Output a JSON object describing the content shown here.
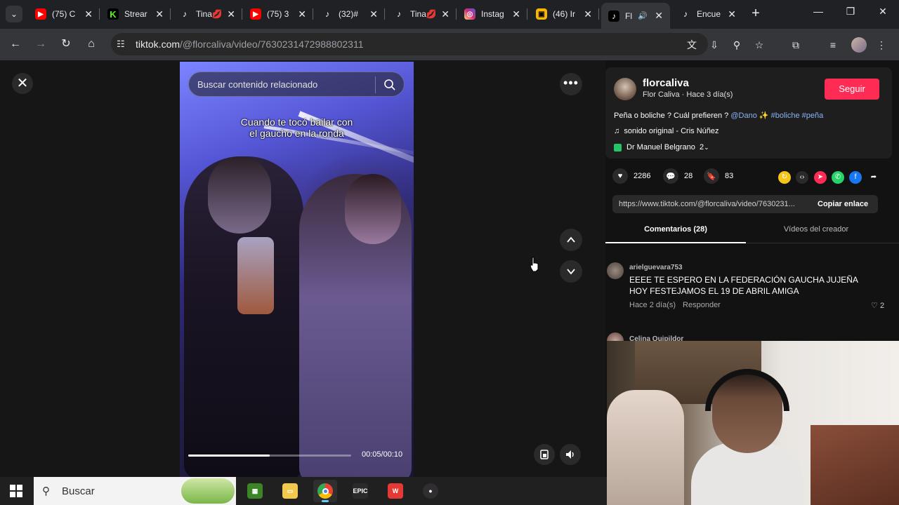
{
  "browser": {
    "tabs": [
      {
        "title": "(75) C",
        "icon": "youtube-icon",
        "color": "#ff0000"
      },
      {
        "title": "Strear",
        "icon": "kick-icon",
        "color": "#53fc18"
      },
      {
        "title": "Tina💋",
        "icon": "tiktok-icon",
        "color": "#ffffff"
      },
      {
        "title": "(75) 3",
        "icon": "youtube-icon",
        "color": "#ff0000"
      },
      {
        "title": "(32)#",
        "icon": "tiktok-icon",
        "color": "#ffffff"
      },
      {
        "title": "Tina💋",
        "icon": "tiktok-icon",
        "color": "#ffffff"
      },
      {
        "title": "Instag",
        "icon": "instagram-icon",
        "color": "#e1306c"
      },
      {
        "title": "(46) Ir",
        "icon": "gallery-icon",
        "color": "#f7b500"
      },
      {
        "title": "Fl",
        "icon": "tiktok-icon",
        "color": "#ffffff",
        "active": true
      },
      {
        "title": "Encue",
        "icon": "tiktok-icon",
        "color": "#ffffff"
      }
    ],
    "url_host": "tiktok.com",
    "url_path": "/@florcaliva/video/7630231472988802311"
  },
  "player": {
    "search_placeholder": "Buscar contenido relacionado",
    "caption_line1": "Cuando te tocó bailar con",
    "caption_line2": "el gaucho en la ronda",
    "time": "00:05/00:10",
    "progress": 0.5
  },
  "post": {
    "username": "florcaliva",
    "subline": "Flor Caliva · Hace 3 día(s)",
    "follow_label": "Seguir",
    "desc_text": "Peña o boliche ? Cuál prefieren ? ",
    "desc_mention": "@Dano",
    "desc_sparkle": " ✨",
    "desc_tags": "#boliche #peña",
    "sound": "sonido original - Cris Núñez",
    "place": "Dr Manuel Belgrano",
    "place_count": "2",
    "likes": "2286",
    "comments": "28",
    "saves": "83",
    "link_url": "https://www.tiktok.com/@florcaliva/video/7630231...",
    "copy_label": "Copiar enlace",
    "tab_comments": "Comentarios (28)",
    "tab_videos": "Vídeos del creador"
  },
  "comments": [
    {
      "user": "arielguevara753",
      "text": "EEEE TE ESPERO EN LA FEDERACIÓN GAUCHA JUJEÑA HOY FESTEJAMOS EL 19 DE ABRIL AMIGA",
      "age": "Hace 2 día(s)",
      "reply": "Responder",
      "likes": "2"
    },
    {
      "user": "Celina Quipildor"
    }
  ],
  "taskbar": {
    "search_label": "Buscar",
    "apps": [
      "minecraft-icon",
      "file-explorer-icon",
      "chrome-icon",
      "epic-games-icon",
      "wps-icon",
      "obs-icon"
    ]
  }
}
